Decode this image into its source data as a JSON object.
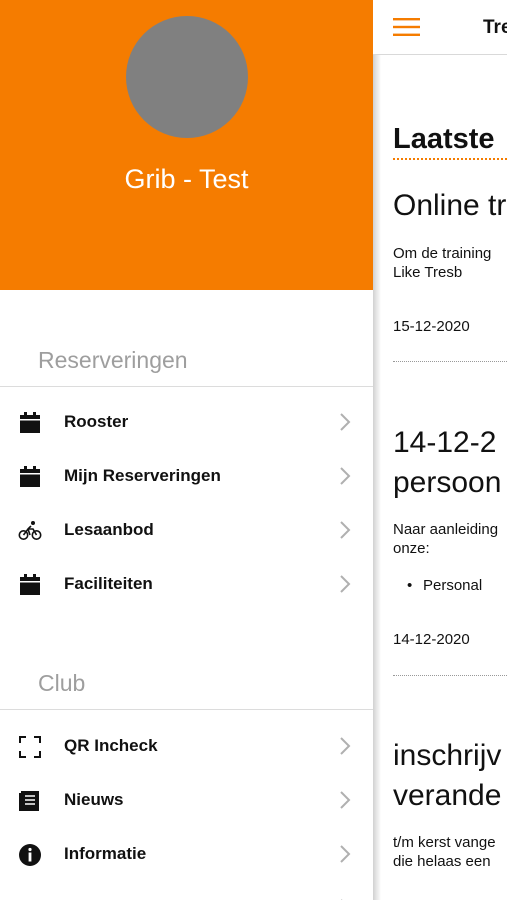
{
  "drawer": {
    "profile_name": "Grib - Test",
    "sections": [
      {
        "title": "Reserveringen",
        "items": [
          {
            "label": "Rooster",
            "icon": "calendar-icon"
          },
          {
            "label": "Mijn Reserveringen",
            "icon": "calendar-icon"
          },
          {
            "label": "Lesaanbod",
            "icon": "bicycle-icon"
          },
          {
            "label": "Faciliteiten",
            "icon": "calendar-icon"
          }
        ]
      },
      {
        "title": "Club",
        "items": [
          {
            "label": "QR Incheck",
            "icon": "qr-scan-icon"
          },
          {
            "label": "Nieuws",
            "icon": "news-icon"
          },
          {
            "label": "Informatie",
            "icon": "info-icon"
          }
        ]
      }
    ]
  },
  "main": {
    "app_title": "Tre",
    "news_heading": "Laatste",
    "articles": [
      {
        "title_lines": [
          "Online tr"
        ],
        "body_lines": [
          "Om de training",
          "Like Tresb"
        ],
        "date": "15-12-2020"
      },
      {
        "title_lines": [
          "14-12-2",
          "persoon"
        ],
        "body_lines": [
          "Naar aanleiding",
          "onze:"
        ],
        "bullet": "Personal",
        "date": "14-12-2020"
      },
      {
        "title_lines": [
          "inschrijv",
          "verande"
        ],
        "body_lines": [
          "t/m kerst vange",
          "die helaas een"
        ]
      }
    ]
  },
  "colors": {
    "accent": "#f57c00",
    "avatar": "#808080",
    "section_title": "#9e9e9e"
  }
}
